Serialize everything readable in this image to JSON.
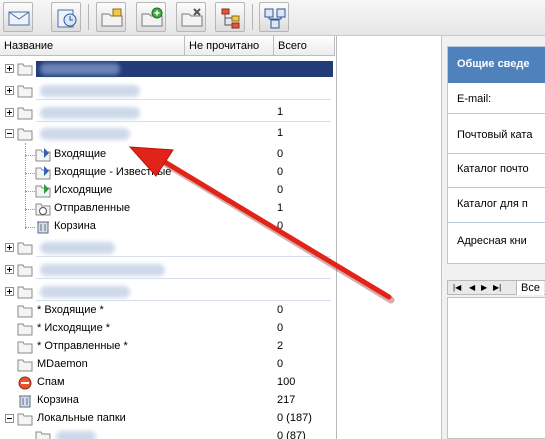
{
  "tree": {
    "columns": {
      "name": "Название",
      "unread": "Не прочитано",
      "total": "Всего"
    },
    "rows": [
      {
        "name": "",
        "unread": ""
      },
      {
        "name": "",
        "unread": ""
      },
      {
        "name": "",
        "unread": "1"
      },
      {
        "name": "",
        "unread": "1"
      },
      {
        "name": "Входящие",
        "unread": "0"
      },
      {
        "name": "Входящие - Известные",
        "unread": "0"
      },
      {
        "name": "Исходящие",
        "unread": "0"
      },
      {
        "name": "Отправленные",
        "unread": "1"
      },
      {
        "name": "Корзина",
        "unread": "0"
      },
      {
        "name": "",
        "unread": ""
      },
      {
        "name": "",
        "unread": ""
      },
      {
        "name": "",
        "unread": ""
      },
      {
        "name": "* Входящие *",
        "unread": "0"
      },
      {
        "name": "* Исходящие *",
        "unread": "0"
      },
      {
        "name": "* Отправленные *",
        "unread": "2"
      },
      {
        "name": "MDaemon",
        "unread": "0"
      },
      {
        "name": "Спам",
        "unread": "100"
      },
      {
        "name": "Корзина",
        "unread": "217"
      },
      {
        "name": "Локальные папки",
        "unread": "0 (187)"
      },
      {
        "name": "",
        "unread": "0 (87)"
      }
    ]
  },
  "info_panel": {
    "title": "Общие сведе",
    "rows": [
      "E-mail:",
      "Почтовый ката",
      "Каталог почто",
      "Каталог для п",
      "Адресная кни"
    ],
    "pager_tab": "Все"
  },
  "toolbar": {
    "buttons": [
      "mail-icon",
      "settings-clock-icon",
      "folder-lock-icon",
      "folder-add-icon",
      "folder-tools-icon",
      "tree-icon",
      "network-icon"
    ]
  },
  "colors": {
    "selection": "#223c7a",
    "arrow": "#e2231a",
    "info_header": "#4f81bd"
  }
}
